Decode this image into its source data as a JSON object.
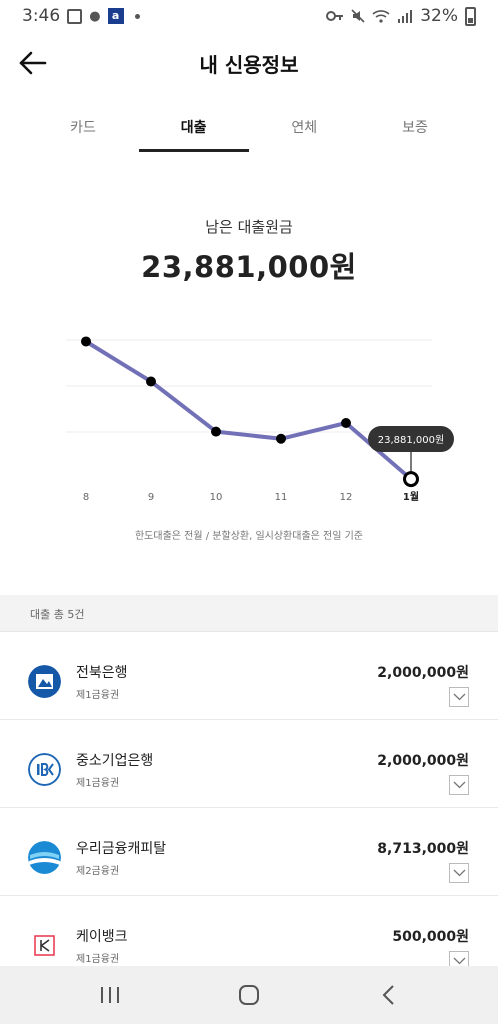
{
  "status_bar": {
    "time": "3:46",
    "battery_text": "32%",
    "icons": [
      "image-icon",
      "pill-icon",
      "app-a-icon",
      "dot-icon",
      "key-icon",
      "mute-icon",
      "wifi-icon",
      "signal-icon",
      "battery-icon"
    ]
  },
  "header": {
    "title": "내 신용정보",
    "back_icon": "arrow-left-icon"
  },
  "tabs": [
    {
      "label": "카드",
      "active": false
    },
    {
      "label": "대출",
      "active": true
    },
    {
      "label": "연체",
      "active": false
    },
    {
      "label": "보증",
      "active": false
    }
  ],
  "summary": {
    "label": "남은 대출원금",
    "amount": "23,881,000원"
  },
  "chart_data": {
    "type": "line",
    "categories": [
      "8",
      "9",
      "10",
      "11",
      "12",
      "1월"
    ],
    "values": [
      33500000,
      30700000,
      27200000,
      26700000,
      27800000,
      23881000
    ],
    "highlight_index": 5,
    "tooltip": "23,881,000원",
    "ylim": [
      22000000,
      35000000
    ],
    "grid": true,
    "colors": {
      "line": "#7271b8",
      "point": "#000000"
    }
  },
  "chart_note": "한도대출은 전월 / 분할상환, 일시상환대출은 전일 기준",
  "loans": {
    "header": "대출 총 5건",
    "items": [
      {
        "name": "전북은행",
        "tier": "제1금융권",
        "amount": "2,000,000원",
        "logo": "jeonbuk-bank-logo"
      },
      {
        "name": "중소기업은행",
        "tier": "제1금융권",
        "amount": "2,000,000원",
        "logo": "ibk-bank-logo"
      },
      {
        "name": "우리금융캐피탈",
        "tier": "제2금융권",
        "amount": "8,713,000원",
        "logo": "woori-capital-logo"
      },
      {
        "name": "케이뱅크",
        "tier": "제1금융권",
        "amount": "500,000원",
        "logo": "kbank-logo"
      }
    ]
  },
  "nav_bar": {
    "icons": [
      "recent-apps-icon",
      "home-icon",
      "back-icon"
    ]
  },
  "colors": {
    "accent_line": "#7271b8",
    "tab_indicator": "#222222",
    "jeonbuk_blue": "#1558a8",
    "ibk_blue": "#1e67b5",
    "woori_blue": "#1a8ad4",
    "kbank_red": "#e8334a"
  }
}
